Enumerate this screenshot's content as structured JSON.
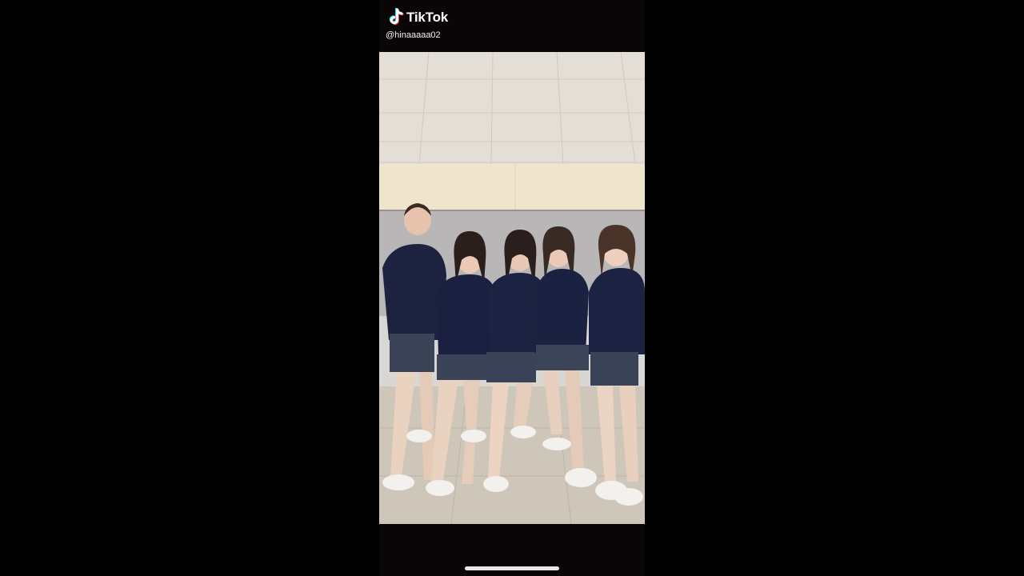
{
  "watermark": {
    "brand": "TikTok",
    "handle": "@hinaaaaa02",
    "icon": "tiktok-logo-icon"
  },
  "video": {
    "description": "",
    "colors": {
      "ceiling": "#e6e1d8",
      "wall_upper": "#efe6cf",
      "wall": "#b9b7b6",
      "floor": "#d2c9bd",
      "sweater": "#1c2140",
      "skirt": "#3a4357"
    }
  },
  "system": {
    "home_indicator": "home-indicator"
  }
}
